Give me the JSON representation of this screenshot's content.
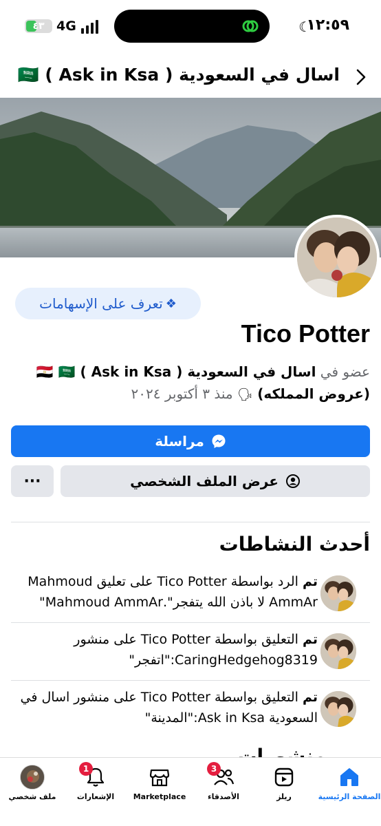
{
  "status_bar": {
    "time": "١٢:٥٩",
    "network": "4G",
    "battery": "٤٣",
    "battery_level": 0.43
  },
  "nav": {
    "title": "اسال في السعودية ( Ask in Ksa ) 🇪🇬 🇸🇦 (..."
  },
  "profile": {
    "name": "Tico Potter",
    "contributions_label": "تعرف على الإسهامات",
    "member_prefix": "عضو في",
    "group_name": "اسال في السعودية ( Ask in Ksa ) 🇪🇬 🇸🇦 (عروض المملكه)",
    "member_since": "منذ ٣ أكتوبر ٢٠٢٤",
    "message_label": "مراسلة",
    "view_profile_label": "عرض الملف الشخصي",
    "more_label": "···"
  },
  "activity": {
    "title": "أحدث النشاطات",
    "items": [
      {
        "done": "تم",
        "action": " الرد بواسطة ",
        "actor": "Tico Potter",
        "rest": " على تعليق Mahmoud AmmAr لا باذن الله يتفجر\".Mahmoud AmmAr\""
      },
      {
        "done": "تم",
        "action": " التعليق بواسطة ",
        "actor": "Tico Potter",
        "rest": " على منشور CaringHedgehog8319:\"اتفجر\""
      },
      {
        "done": "تم",
        "action": " التعليق بواسطة ",
        "actor": "Tico Potter",
        "rest": " على منشور اسال في السعودية Ask in Ksa:\"المدينة\""
      }
    ]
  },
  "partial_section": "منشورات المجموعة",
  "tabs": [
    {
      "label": "الصفحة الرئيسية",
      "icon": "home-icon",
      "active": true
    },
    {
      "label": "ريلز",
      "icon": "reels-icon",
      "active": false
    },
    {
      "label": "الأصدقاء",
      "icon": "friends-icon",
      "active": false,
      "badge": "3"
    },
    {
      "label": "Marketplace",
      "icon": "marketplace-icon",
      "active": false
    },
    {
      "label": "الإشعارات",
      "icon": "bell-icon",
      "active": false,
      "badge": "1"
    },
    {
      "label": "ملف شخصي",
      "icon": "profile-avatar",
      "active": false
    }
  ],
  "colors": {
    "accent": "#1877f2",
    "badge": "#e41e3f",
    "secondary_button": "#e4e6eb",
    "contrib_bg": "#e7f0fd"
  }
}
